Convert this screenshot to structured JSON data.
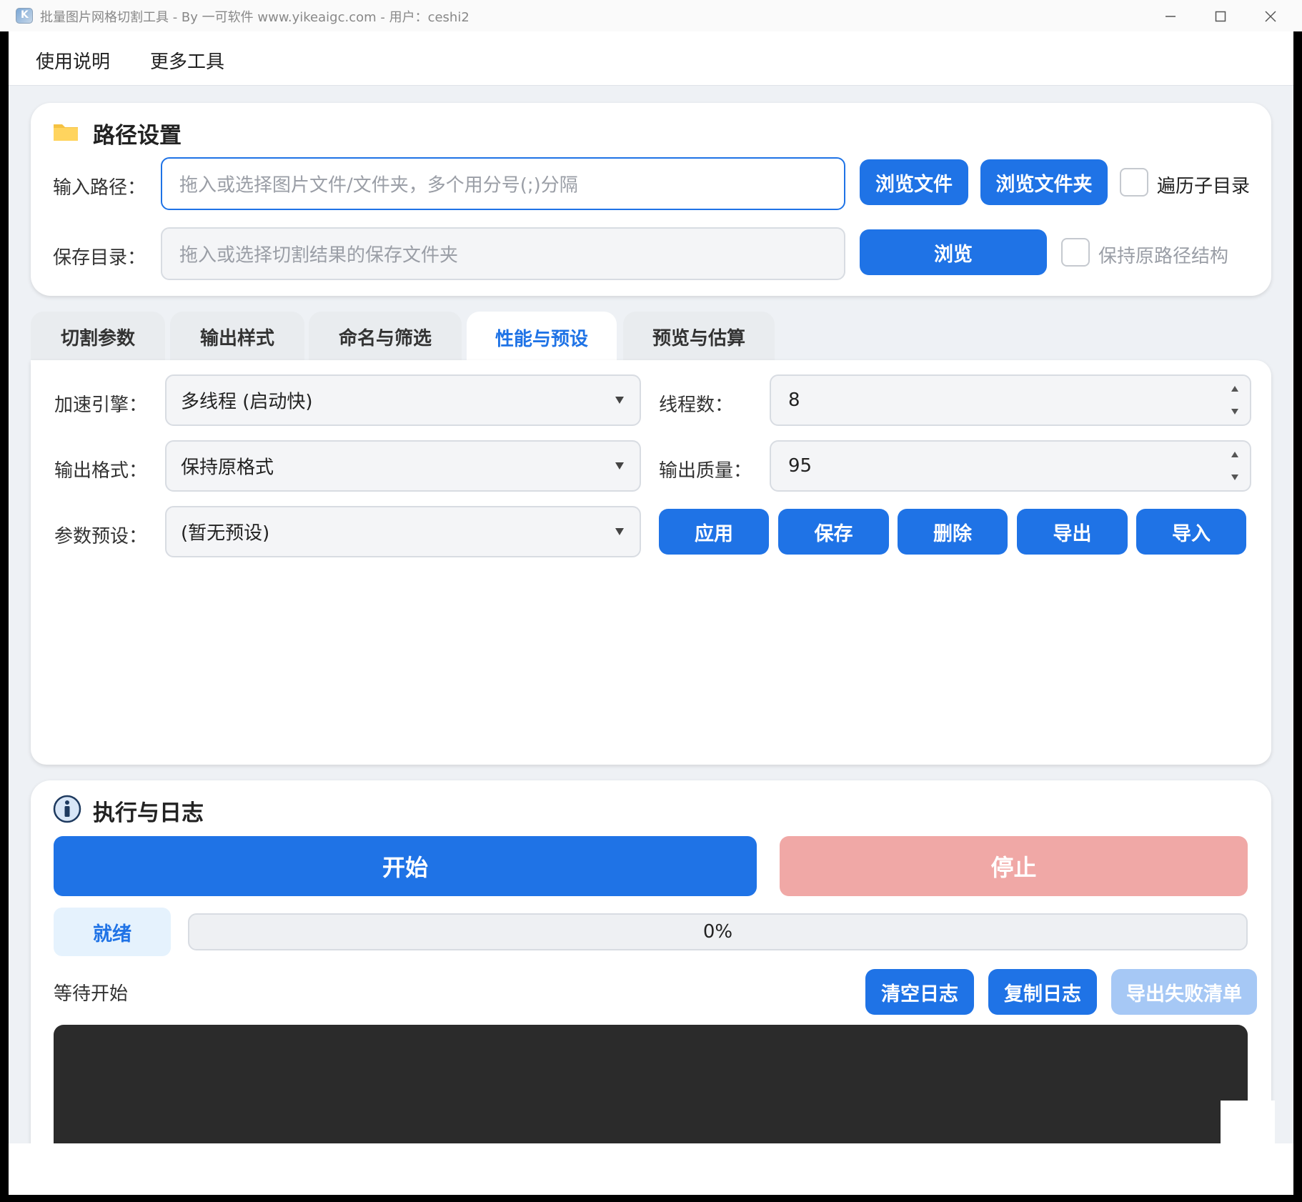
{
  "window": {
    "title": "批量图片网格切割工具 - By 一可软件 www.yikeaigc.com  -  用户：ceshi2"
  },
  "menu": [
    "使用说明",
    "更多工具"
  ],
  "path_settings": {
    "title": "路径设置",
    "input_label": "输入路径：",
    "input_placeholder": "拖入或选择图片文件/文件夹，多个用分号(;)分隔",
    "browse_file": "浏览文件",
    "browse_folder": "浏览文件夹",
    "traverse_subdirs": "遍历子目录",
    "save_label": "保存目录：",
    "save_placeholder": "拖入或选择切割结果的保存文件夹",
    "browse": "浏览",
    "keep_structure": "保持原路径结构"
  },
  "tabs": [
    {
      "label": "切割参数",
      "active": false
    },
    {
      "label": "输出样式",
      "active": false
    },
    {
      "label": "命名与筛选",
      "active": false
    },
    {
      "label": "性能与预设",
      "active": true
    },
    {
      "label": "预览与估算",
      "active": false
    }
  ],
  "perf": {
    "engine_label": "加速引擎：",
    "engine_value": "多线程 (启动快)",
    "threads_label": "线程数：",
    "threads_value": "8",
    "format_label": "输出格式：",
    "format_value": "保持原格式",
    "quality_label": "输出质量：",
    "quality_value": "95",
    "preset_label": "参数预设：",
    "preset_value": "(暂无预设)",
    "preset_buttons": [
      "应用",
      "保存",
      "删除",
      "导出",
      "导入"
    ]
  },
  "exec": {
    "title": "执行与日志",
    "start": "开始",
    "stop": "停止",
    "status": "就绪",
    "progress_percent": 0,
    "progress_text": "0%",
    "waiting": "等待开始",
    "clear_log": "清空日志",
    "copy_log": "复制日志",
    "export_failed": "导出失败清单"
  },
  "colors": {
    "accent": "#1f73e6",
    "stop_disabled": "#f0a8a6",
    "export_disabled": "#a6c8f5",
    "log_bg": "#2b2b2b"
  }
}
